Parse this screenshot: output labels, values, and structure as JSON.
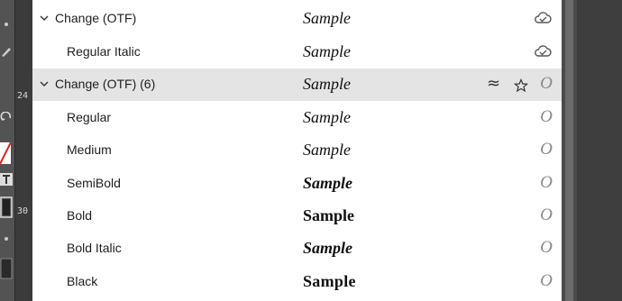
{
  "ruler": {
    "mark_top": "24",
    "mark_bottom": "30"
  },
  "rows": [
    {
      "kind": "family",
      "name": "Change (OTF)",
      "sample": "Sample",
      "weight": "italic",
      "icon": "cloud-sync-icon"
    },
    {
      "kind": "style",
      "name": "Regular Italic",
      "sample": "Sample",
      "weight": "italic",
      "icon": "cloud-sync-icon"
    },
    {
      "kind": "family",
      "name": "Change (OTF) (6)",
      "sample": "Sample",
      "weight": "italic",
      "icon": "otf-icon",
      "otf_glyph": "O",
      "similar_glyph": "≈",
      "highlighted": true
    },
    {
      "kind": "style",
      "name": "Regular",
      "sample": "Sample",
      "weight": "italic",
      "icon": "otf-icon",
      "otf_glyph": "O"
    },
    {
      "kind": "style",
      "name": "Medium",
      "sample": "Sample",
      "weight": "medium",
      "icon": "otf-icon",
      "otf_glyph": "O"
    },
    {
      "kind": "style",
      "name": "SemiBold",
      "sample": "Sample",
      "weight": "semibold",
      "icon": "otf-icon",
      "otf_glyph": "O"
    },
    {
      "kind": "style",
      "name": "Bold",
      "sample": "Sample",
      "weight": "bold",
      "icon": "otf-icon",
      "otf_glyph": "O"
    },
    {
      "kind": "style",
      "name": "Bold Italic",
      "sample": "Sample",
      "weight": "bolditalic",
      "icon": "otf-icon",
      "otf_glyph": "O"
    },
    {
      "kind": "style",
      "name": "Black",
      "sample": "Sample",
      "weight": "black",
      "icon": "otf-icon",
      "otf_glyph": "O"
    }
  ],
  "colors": {
    "highlight": "#e4e4e4",
    "panel": "#ffffff",
    "chrome": "#4a4a4a",
    "otf_icon": "#8a8a8a"
  }
}
